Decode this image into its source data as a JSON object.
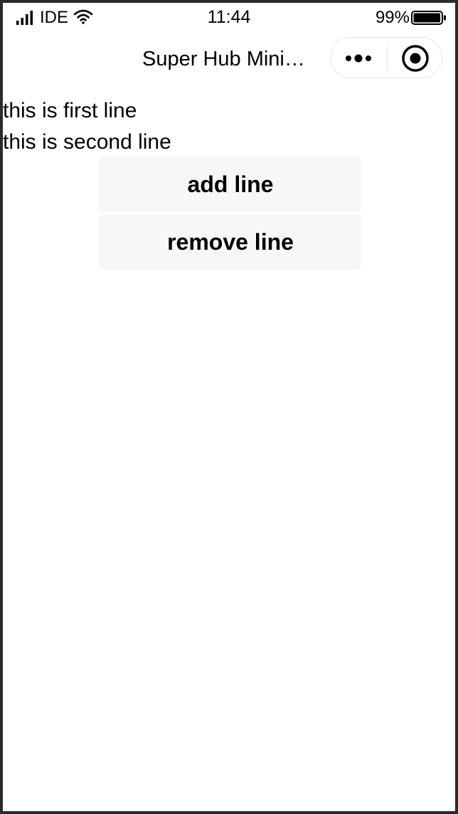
{
  "status_bar": {
    "carrier": "IDE",
    "time": "11:44",
    "battery_percent": "99%",
    "battery_level": 0.99,
    "icons": [
      "signal-icon",
      "wifi-icon",
      "battery-icon"
    ]
  },
  "nav_bar": {
    "title": "Super Hub Mini…",
    "capsule_icons": [
      "more-dots-icon",
      "close-target-icon"
    ]
  },
  "content": {
    "lines": [
      "this is first line",
      "this is second line"
    ],
    "buttons": {
      "add_label": "add line",
      "remove_label": "remove line"
    }
  },
  "colors": {
    "background": "#ffffff",
    "button_background": "#f7f7f7",
    "text": "#000000",
    "frame": "#2b2b2b"
  }
}
